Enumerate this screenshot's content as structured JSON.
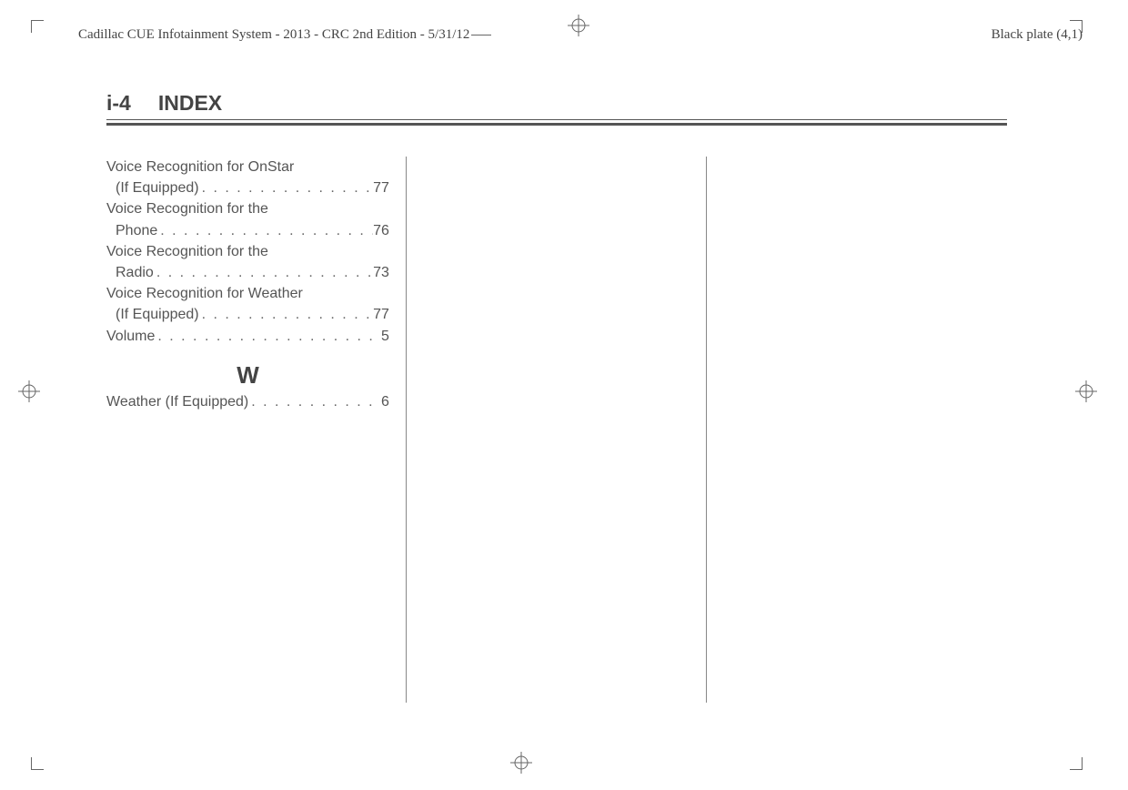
{
  "header": {
    "doc_title": "Cadillac CUE Infotainment System - 2013 - CRC 2nd Edition - 5/31/12",
    "plate_label": "Black plate (4,1)"
  },
  "page": {
    "number": "i-4",
    "title": "INDEX"
  },
  "index": {
    "continued_entries": [
      {
        "line1": "Voice Recognition for OnStar",
        "line2": "(If Equipped)",
        "page": "77"
      },
      {
        "line1": "Voice Recognition for the",
        "line2": "Phone",
        "page": "76"
      },
      {
        "line1": "Voice Recognition for the",
        "line2": "Radio",
        "page": "73"
      },
      {
        "line1": "Voice Recognition for Weather",
        "line2": "(If Equipped)",
        "page": "77"
      },
      {
        "line1": "Volume",
        "page": "5"
      }
    ],
    "sections": [
      {
        "letter": "W",
        "entries": [
          {
            "line1": "Weather (If Equipped)",
            "page": "6"
          }
        ]
      }
    ]
  }
}
